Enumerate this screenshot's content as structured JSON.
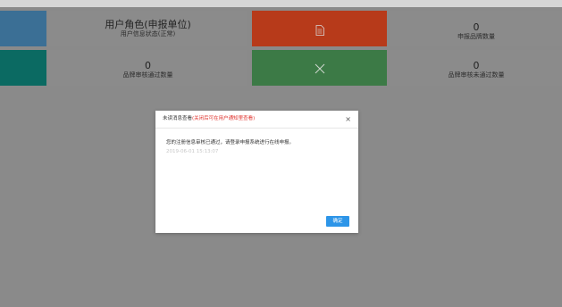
{
  "tiles": {
    "role": {
      "title": "用户角色(申报单位)",
      "subtitle": "用户信息状态(正常)"
    },
    "apply": {
      "count": "0",
      "label": "申报品牌数量"
    },
    "passed": {
      "count": "0",
      "label": "品牌审核通过数量"
    },
    "failed": {
      "count": "0",
      "label": "品牌审核未通过数量"
    },
    "doc_icon": "document-icon",
    "x_icon": "close-icon"
  },
  "colors": {
    "blue_tile": "#3b6f95",
    "teal_tile": "#0b6a62",
    "orange_tile": "#b73a1a",
    "green_tile": "#3c7a46",
    "ok_button": "#2d95e8",
    "warning_text": "#e0332d"
  },
  "modal": {
    "title": "未读消息查看",
    "note": "(关闭后可在用户通知里查看)",
    "close": "×",
    "message": "您的注册信息审核已通过，请登录申报系统进行在线申报。",
    "timestamp": "2019-06-01 15:13:07",
    "ok_label": "确定"
  }
}
